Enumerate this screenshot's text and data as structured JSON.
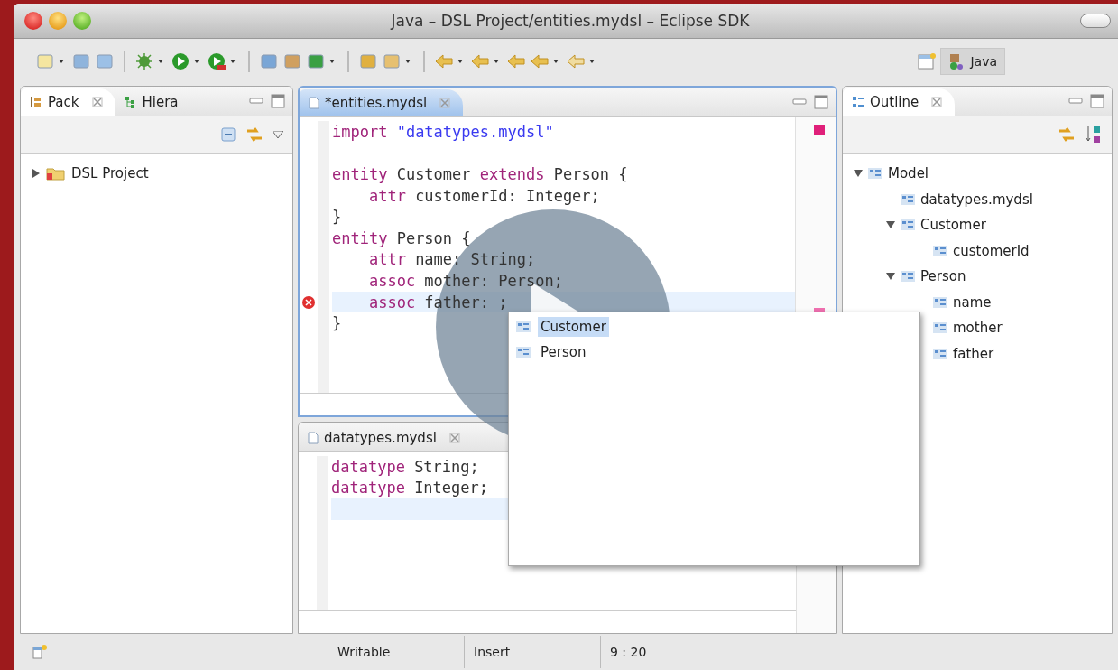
{
  "window": {
    "title": "Java – DSL Project/entities.mydsl – Eclipse SDK"
  },
  "perspective": {
    "label": "Java",
    "selected": true
  },
  "left_panel": {
    "tabs": [
      {
        "label": "Pack",
        "selected": true
      },
      {
        "label": "Hiera",
        "selected": false
      }
    ],
    "tree": [
      {
        "label": "DSL Project",
        "expanded": false
      }
    ]
  },
  "editors": [
    {
      "tab": {
        "label": "*entities.mydsl",
        "selected": true
      },
      "lines": [
        {
          "kind": "code",
          "current": false,
          "error": false,
          "tokens": [
            {
              "kind": "keyword",
              "text": "import"
            },
            {
              "kind": "string",
              "text": " \"datatypes.mydsl\""
            }
          ]
        },
        {
          "kind": "blank",
          "current": false,
          "error": false
        },
        {
          "kind": "code",
          "current": false,
          "error": false,
          "tokens": [
            {
              "kind": "keyword",
              "text": "entity"
            },
            {
              "kind": "plain",
              "text": " Customer "
            },
            {
              "kind": "keyword",
              "text": "extends"
            },
            {
              "kind": "plain",
              "text": " Person {"
            }
          ]
        },
        {
          "kind": "code",
          "current": false,
          "error": false,
          "tokens": [
            {
              "kind": "keyword",
              "text": "    attr"
            },
            {
              "kind": "plain",
              "text": " customerId: Integer;"
            }
          ]
        },
        {
          "kind": "code",
          "current": false,
          "error": false,
          "tokens": [
            {
              "kind": "plain",
              "text": "}"
            }
          ]
        },
        {
          "kind": "code",
          "current": false,
          "error": false,
          "tokens": [
            {
              "kind": "keyword",
              "text": "entity"
            },
            {
              "kind": "plain",
              "text": " Person {"
            }
          ]
        },
        {
          "kind": "code",
          "current": false,
          "error": false,
          "tokens": [
            {
              "kind": "keyword",
              "text": "    attr"
            },
            {
              "kind": "plain",
              "text": " name: String;"
            }
          ]
        },
        {
          "kind": "code",
          "current": false,
          "error": false,
          "tokens": [
            {
              "kind": "keyword",
              "text": "    assoc"
            },
            {
              "kind": "plain",
              "text": " mother: Person;"
            }
          ]
        },
        {
          "kind": "code",
          "current": true,
          "error": true,
          "tokens": [
            {
              "kind": "keyword",
              "text": "    assoc"
            },
            {
              "kind": "plain",
              "text": " father: ;"
            }
          ]
        },
        {
          "kind": "code",
          "current": false,
          "error": false,
          "tokens": [
            {
              "kind": "plain",
              "text": "}"
            }
          ]
        }
      ]
    },
    {
      "tab": {
        "label": "datatypes.mydsl",
        "selected": false
      },
      "lines": [
        {
          "kind": "code",
          "current": false,
          "error": false,
          "tokens": [
            {
              "kind": "keyword",
              "text": "datatype"
            },
            {
              "kind": "plain",
              "text": " String;"
            }
          ]
        },
        {
          "kind": "code",
          "current": false,
          "error": false,
          "tokens": [
            {
              "kind": "keyword",
              "text": "datatype"
            },
            {
              "kind": "plain",
              "text": " Integer;"
            }
          ]
        },
        {
          "kind": "blank",
          "current": true,
          "error": false
        }
      ]
    }
  ],
  "completion": {
    "items": [
      {
        "label": "Customer",
        "selected": true
      },
      {
        "label": "Person",
        "selected": false
      }
    ]
  },
  "outline": {
    "tab": {
      "label": "Outline",
      "selected": true
    },
    "tree": [
      {
        "label": "Model",
        "expanded": true,
        "children": [
          {
            "label": "datatypes.mydsl"
          },
          {
            "label": "Customer",
            "expanded": true,
            "children": [
              {
                "label": "customerId"
              }
            ]
          },
          {
            "label": "Person",
            "expanded": true,
            "children": [
              {
                "label": "name"
              },
              {
                "label": "mother"
              },
              {
                "label": "father"
              }
            ]
          }
        ]
      }
    ]
  },
  "status_bar": {
    "items": [
      "Writable",
      "Insert",
      "9 : 20"
    ]
  }
}
